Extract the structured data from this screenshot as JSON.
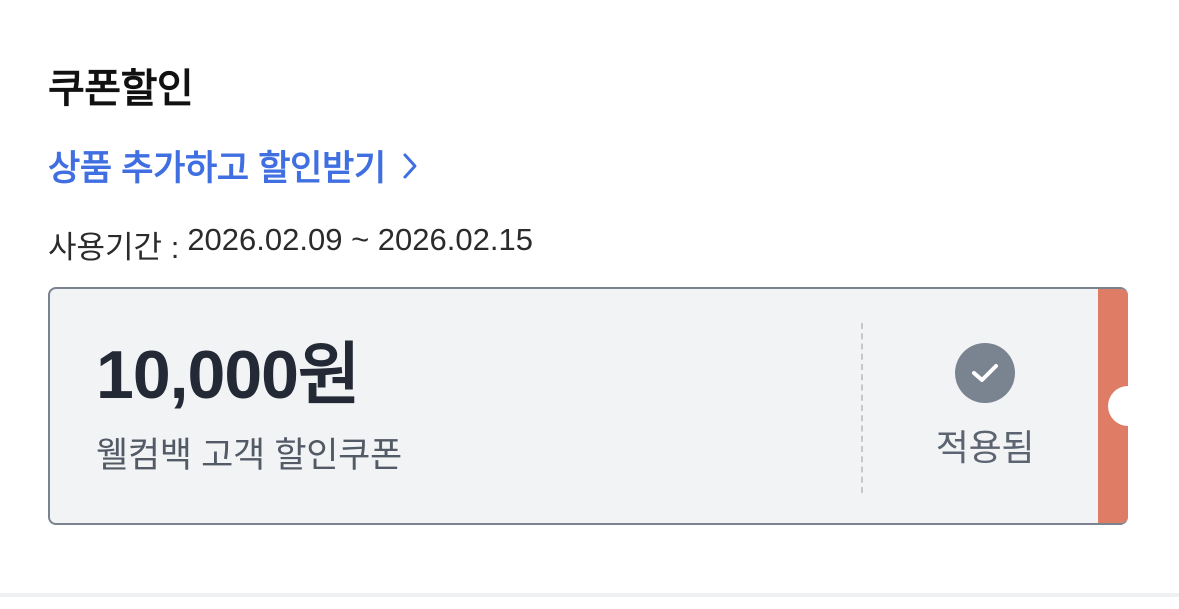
{
  "section": {
    "title": "쿠폰할인",
    "promo_link_label": "상품 추가하고 할인받기",
    "period_label": "사용기간 :",
    "period_value": "2026.02.09 ~ 2026.02.15"
  },
  "coupon": {
    "amount": "10,000원",
    "name": "웰컴백 고객 할인쿠폰",
    "status_label": "적용됨",
    "status_icon": "check-icon",
    "strip_color": "#df7c66"
  },
  "colors": {
    "link": "#3f6fe0",
    "coupon_bg": "#f2f3f5",
    "coupon_border": "#7c8390",
    "check_bg": "#7a8390"
  }
}
